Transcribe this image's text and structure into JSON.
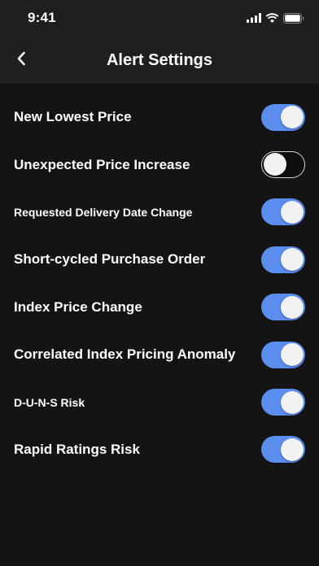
{
  "status_bar": {
    "time": "9:41",
    "icons": [
      "cellular-signal-icon",
      "wifi-icon",
      "battery-icon"
    ]
  },
  "header": {
    "title": "Alert Settings",
    "back_icon": "chevron-left-icon"
  },
  "colors": {
    "background": "#141414",
    "header_background": "#1f1f1f",
    "toggle_on": "#5b8def",
    "toggle_off": "#0f0f0f",
    "knob": "#f2f2f2"
  },
  "alerts": [
    {
      "label": "New Lowest Price",
      "enabled": true
    },
    {
      "label": "Unexpected Price Increase",
      "enabled": false
    },
    {
      "label": "Requested Delivery Date Change",
      "enabled": true
    },
    {
      "label": "Short-cycled Purchase Order",
      "enabled": true
    },
    {
      "label": "Index Price Change",
      "enabled": true
    },
    {
      "label": "Correlated Index Pricing Anomaly",
      "enabled": true
    },
    {
      "label": "D-U-N-S Risk",
      "enabled": true
    },
    {
      "label": "Rapid Ratings Risk",
      "enabled": true
    }
  ]
}
